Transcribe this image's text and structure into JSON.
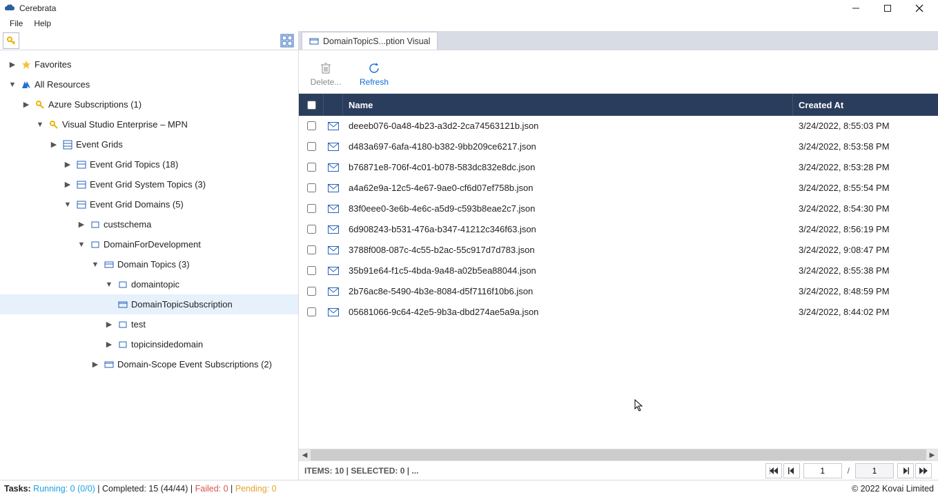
{
  "app_title": "Cerebrata",
  "menu": {
    "file": "File",
    "help": "Help"
  },
  "tab": {
    "label": "DomainTopicS...ption Visual"
  },
  "tree": {
    "favorites": "Favorites",
    "all_resources": "All Resources",
    "az_subs": "Azure Subscriptions (1)",
    "vs_ent": "Visual Studio Enterprise – MPN",
    "event_grids": "Event Grids",
    "eg_topics": "Event Grid Topics (18)",
    "eg_system": "Event Grid System Topics (3)",
    "eg_domains": "Event Grid Domains (5)",
    "custschema": "custschema",
    "dom_dev": "DomainForDevelopment",
    "domain_topics": "Domain Topics (3)",
    "domaintopic": "domaintopic",
    "dts": "DomainTopicSubscription",
    "test": "test",
    "topicinside": "topicinsidedomain",
    "domain_scope": "Domain-Scope Event Subscriptions (2)"
  },
  "actions": {
    "delete": "Delete...",
    "refresh": "Refresh"
  },
  "columns": {
    "name": "Name",
    "created": "Created At"
  },
  "rows": [
    {
      "name": "deeeb076-0a48-4b23-a3d2-2ca74563121b.json",
      "created": "3/24/2022, 8:55:03 PM"
    },
    {
      "name": "d483a697-6afa-4180-b382-9bb209ce6217.json",
      "created": "3/24/2022, 8:53:58 PM"
    },
    {
      "name": "b76871e8-706f-4c01-b078-583dc832e8dc.json",
      "created": "3/24/2022, 8:53:28 PM"
    },
    {
      "name": "a4a62e9a-12c5-4e67-9ae0-cf6d07ef758b.json",
      "created": "3/24/2022, 8:55:54 PM"
    },
    {
      "name": "83f0eee0-3e6b-4e6c-a5d9-c593b8eae2c7.json",
      "created": "3/24/2022, 8:54:30 PM"
    },
    {
      "name": "6d908243-b531-476a-b347-41212c346f63.json",
      "created": "3/24/2022, 8:56:19 PM"
    },
    {
      "name": "3788f008-087c-4c55-b2ac-55c917d7d783.json",
      "created": "3/24/2022, 9:08:47 PM"
    },
    {
      "name": "35b91e64-f1c5-4bda-9a48-a02b5ea88044.json",
      "created": "3/24/2022, 8:55:38 PM"
    },
    {
      "name": "2b76ac8e-5490-4b3e-8084-d5f7116f10b6.json",
      "created": "3/24/2022, 8:48:59 PM"
    },
    {
      "name": "05681066-9c64-42e5-9b3a-dbd274ae5a9a.json",
      "created": "3/24/2022, 8:44:02 PM"
    }
  ],
  "footer": {
    "items_selected": "ITEMS: 10 | SELECTED: 0 | ...",
    "page": "1",
    "of": "/",
    "total": "1"
  },
  "status": {
    "tasks": "Tasks:",
    "running": " Running: 0 (0/0) ",
    "sep": "|",
    "completed": " Completed: 15 (44/44) ",
    "failed": " Failed: 0 ",
    "pending": " Pending: 0",
    "copyright": "© 2022 Kovai Limited"
  }
}
